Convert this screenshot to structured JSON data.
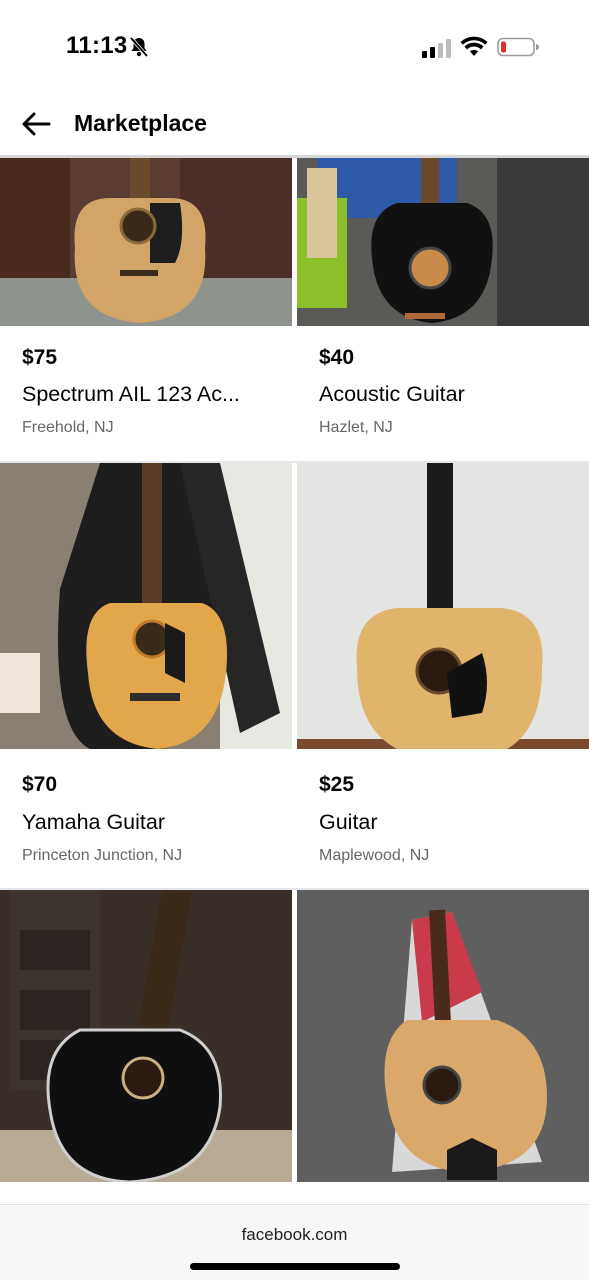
{
  "status": {
    "time": "11:13",
    "battery_color": "#e0302a"
  },
  "header": {
    "title": "Marketplace",
    "back_icon": "arrow-left-icon"
  },
  "listings": [
    {
      "price": "$75",
      "title": "Spectrum AIL 123 Ac...",
      "location": "Freehold, NJ"
    },
    {
      "price": "$40",
      "title": "Acoustic Guitar",
      "location": "Hazlet, NJ"
    },
    {
      "price": "$70",
      "title": "Yamaha Guitar",
      "location": "Princeton Junction, NJ"
    },
    {
      "price": "$25",
      "title": "Guitar",
      "location": "Maplewood, NJ"
    },
    {
      "price": "",
      "title": "",
      "location": ""
    },
    {
      "price": "",
      "title": "",
      "location": ""
    }
  ],
  "footer": {
    "url": "facebook.com"
  }
}
